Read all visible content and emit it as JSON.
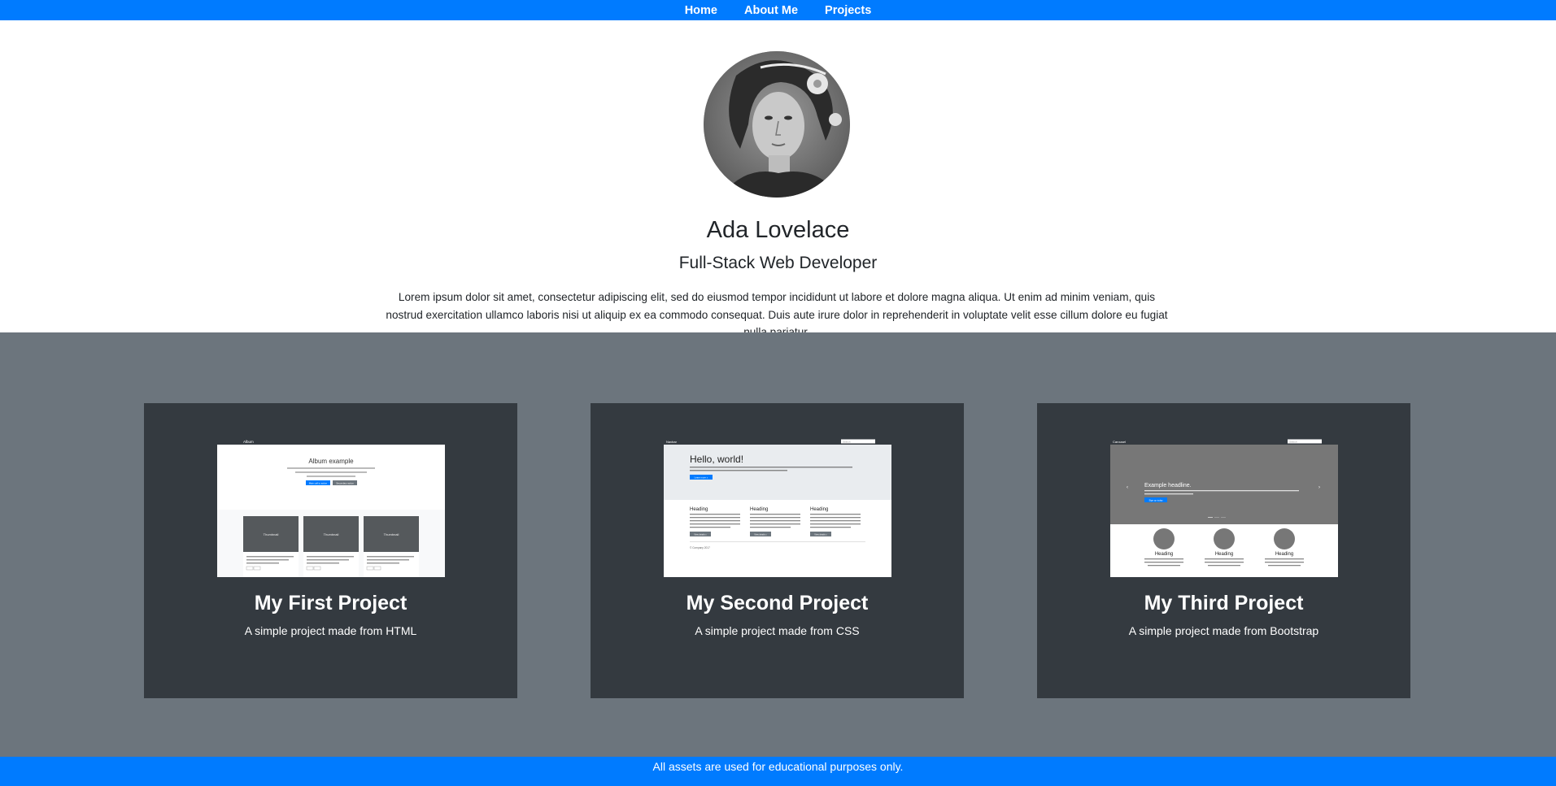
{
  "nav": {
    "items": [
      {
        "label": "Home"
      },
      {
        "label": "About Me"
      },
      {
        "label": "Projects"
      }
    ]
  },
  "profile": {
    "name": "Ada Lovelace",
    "role": "Full-Stack Web Developer",
    "bio": "Lorem ipsum dolor sit amet, consectetur adipiscing elit, sed do eiusmod tempor incididunt ut labore et dolore magna aliqua. Ut enim ad minim veniam, quis nostrud exercitation ullamco laboris nisi ut aliquip ex ea commodo consequat. Duis aute irure dolor in reprehenderit in voluptate velit esse cillum dolore eu fugiat nulla pariatur."
  },
  "projects": [
    {
      "title": "My First Project",
      "description": "A simple project made from HTML",
      "thumb": {
        "brand": "Album",
        "heading": "Album example",
        "primary_button": "Main call to action",
        "secondary_button": "Secondary action",
        "card_label": "Thumbnail"
      }
    },
    {
      "title": "My Second Project",
      "description": "A simple project made from CSS",
      "thumb": {
        "brand": "Navbar",
        "search_placeholder": "Search",
        "hero": "Hello, world!",
        "button": "Learn more »",
        "col_heading": "Heading",
        "col_button": "View details »",
        "footer": "© Company 2017"
      }
    },
    {
      "title": "My Third Project",
      "description": "A simple project made from Bootstrap",
      "thumb": {
        "brand": "Carousel",
        "search_placeholder": "Search",
        "headline": "Example headline.",
        "button": "Sign up today",
        "col_heading": "Heading"
      }
    }
  ],
  "footer": {
    "text": "All assets are used for educational purposes only."
  }
}
